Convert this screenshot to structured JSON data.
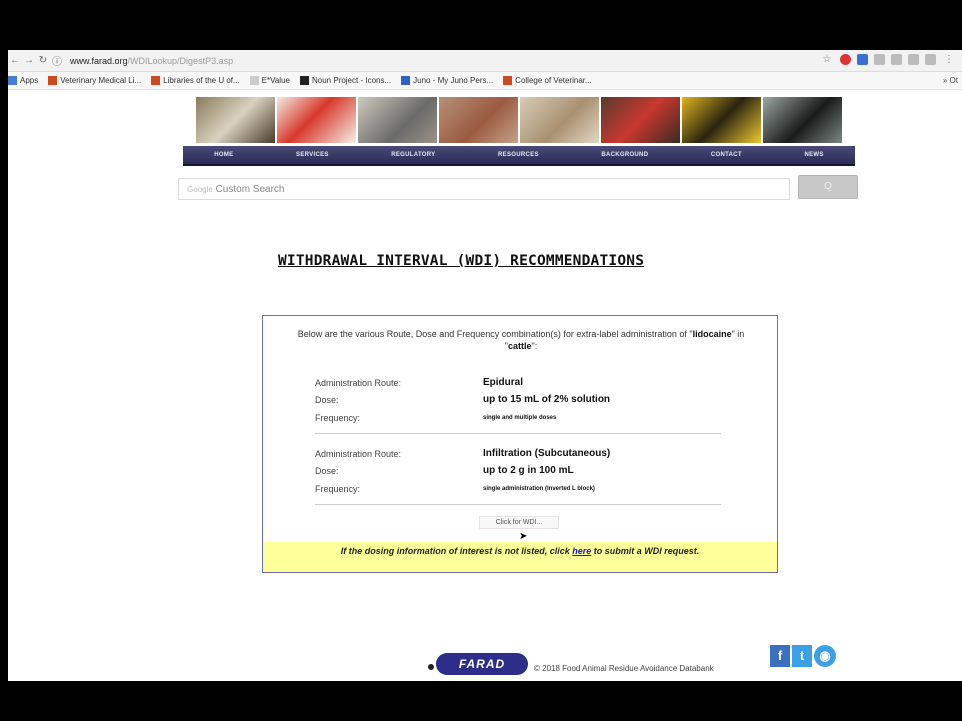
{
  "browser": {
    "url_domain": "www.farad.org",
    "url_path": "/WDILookup/DigestP3.asp",
    "bookmarks": [
      {
        "label": "Apps",
        "icon": "apps-grid-icon"
      },
      {
        "label": "Veterinary Medical Li...",
        "icon": "university-icon"
      },
      {
        "label": "Libraries of the U of...",
        "icon": "university-icon"
      },
      {
        "label": "E*Value",
        "icon": "document-icon"
      },
      {
        "label": "Noun Project - Icons...",
        "icon": "noun-project-icon"
      },
      {
        "label": "Juno - My Juno Pers...",
        "icon": "juno-icon"
      },
      {
        "label": "College of Veterinar...",
        "icon": "university-icon"
      }
    ],
    "bookmarks_other": "» Ot"
  },
  "nav": {
    "items": [
      "HOME",
      "SERVICES",
      "REGULATORY",
      "RESOURCES",
      "BACKGROUND",
      "CONTACT",
      "NEWS"
    ]
  },
  "search": {
    "placeholder_brand": "Google",
    "placeholder": "Custom Search",
    "button_label": "Q"
  },
  "page": {
    "title": "WITHDRAWAL INTERVAL (WDI) RECOMMENDATIONS",
    "intro_pre": "Below are the various Route, Dose and Frequency combination(s) for extra-label administration of \"",
    "drug": "lidocaine",
    "intro_mid": "\" in \"",
    "species": "cattle",
    "intro_post": "\":",
    "labels": {
      "route": "Administration Route:",
      "dose": "Dose:",
      "frequency": "Frequency:"
    },
    "entries": [
      {
        "route": "Epidural",
        "dose": "up to 15 mL of 2% solution",
        "frequency": "single and multiple doses"
      },
      {
        "route": "Infiltration (Subcutaneous)",
        "dose": "up to 2 g in 100 mL",
        "frequency": "single administration (Inverted L block)"
      }
    ],
    "click_button": "Click for WDI...",
    "notice_pre": "If the dosing information of interest is not listed, click ",
    "notice_link": "here",
    "notice_post": " to submit a WDI request."
  },
  "footer": {
    "logo_text": "FARAD",
    "copyright": "© 2018 Food Animal Residue Avoidance Databank",
    "social": [
      "f",
      "t",
      "◉"
    ]
  }
}
